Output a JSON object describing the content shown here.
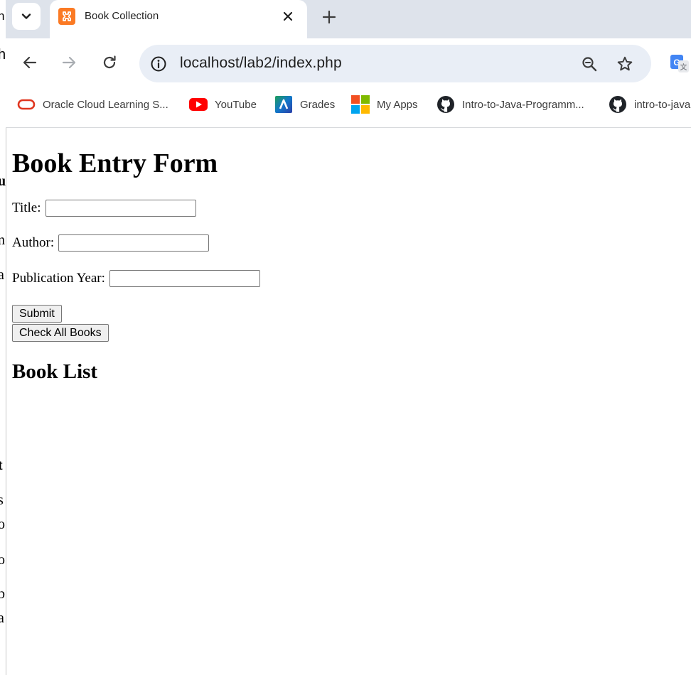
{
  "browser": {
    "tab": {
      "title": "Book Collection",
      "favicon": "xampp-icon"
    },
    "toolbar": {
      "url": "localhost/lab2/index.php"
    },
    "bookmarks": [
      {
        "label": "Oracle Cloud Learning S...",
        "icon": "oracle-icon"
      },
      {
        "label": "YouTube",
        "icon": "youtube-icon"
      },
      {
        "label": "Grades",
        "icon": "grades-icon"
      },
      {
        "label": "My Apps",
        "icon": "microsoft-icon"
      },
      {
        "label": "Intro-to-Java-Programm...",
        "icon": "github-icon"
      },
      {
        "label": "intro-to-java",
        "icon": "github-icon"
      }
    ]
  },
  "background_window": {
    "fragments": [
      "n",
      "h",
      "u",
      "n",
      "a",
      "t",
      "s",
      "o",
      "o",
      "b",
      "a"
    ]
  },
  "page": {
    "title": "Book Entry Form",
    "form": {
      "title_label": "Title:",
      "title_value": "",
      "author_label": "Author:",
      "author_value": "",
      "year_label": "Publication Year:",
      "year_value": "",
      "submit_label": "Submit",
      "check_all_label": "Check All Books"
    },
    "list_heading": "Book List"
  },
  "colors": {
    "tabstrip": "#dee3eb",
    "omnibox": "#e9eef6",
    "xampp_orange": "#fb7a24",
    "youtube_red": "#ff0000"
  }
}
